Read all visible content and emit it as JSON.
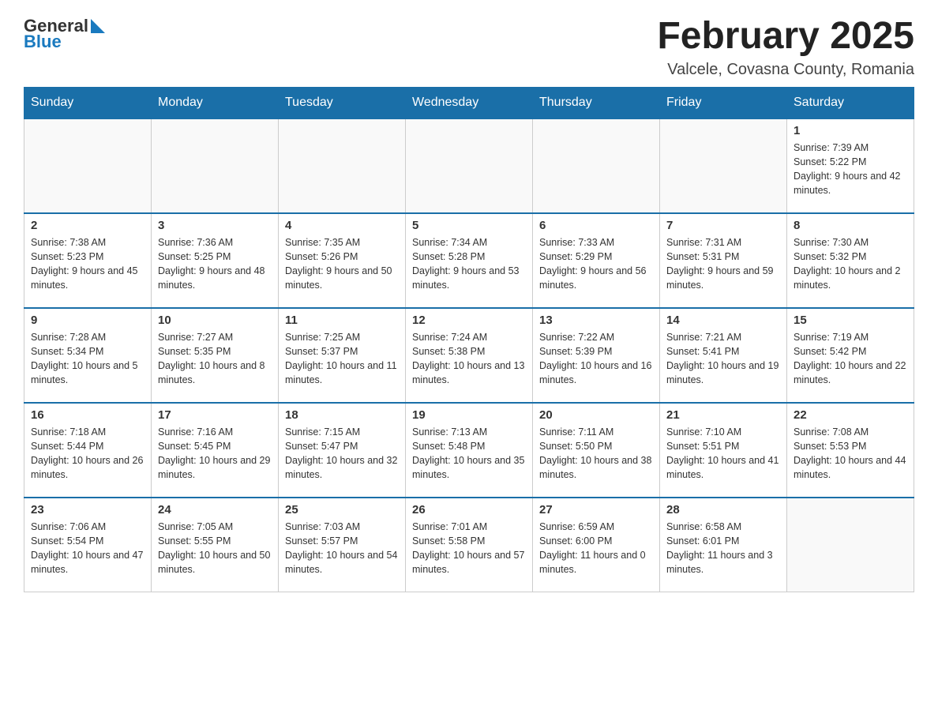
{
  "header": {
    "logo": {
      "text_general": "General",
      "text_blue": "Blue"
    },
    "title": "February 2025",
    "subtitle": "Valcele, Covasna County, Romania"
  },
  "days_of_week": [
    "Sunday",
    "Monday",
    "Tuesday",
    "Wednesday",
    "Thursday",
    "Friday",
    "Saturday"
  ],
  "weeks": [
    [
      {
        "day": "",
        "info": ""
      },
      {
        "day": "",
        "info": ""
      },
      {
        "day": "",
        "info": ""
      },
      {
        "day": "",
        "info": ""
      },
      {
        "day": "",
        "info": ""
      },
      {
        "day": "",
        "info": ""
      },
      {
        "day": "1",
        "info": "Sunrise: 7:39 AM\nSunset: 5:22 PM\nDaylight: 9 hours and 42 minutes."
      }
    ],
    [
      {
        "day": "2",
        "info": "Sunrise: 7:38 AM\nSunset: 5:23 PM\nDaylight: 9 hours and 45 minutes."
      },
      {
        "day": "3",
        "info": "Sunrise: 7:36 AM\nSunset: 5:25 PM\nDaylight: 9 hours and 48 minutes."
      },
      {
        "day": "4",
        "info": "Sunrise: 7:35 AM\nSunset: 5:26 PM\nDaylight: 9 hours and 50 minutes."
      },
      {
        "day": "5",
        "info": "Sunrise: 7:34 AM\nSunset: 5:28 PM\nDaylight: 9 hours and 53 minutes."
      },
      {
        "day": "6",
        "info": "Sunrise: 7:33 AM\nSunset: 5:29 PM\nDaylight: 9 hours and 56 minutes."
      },
      {
        "day": "7",
        "info": "Sunrise: 7:31 AM\nSunset: 5:31 PM\nDaylight: 9 hours and 59 minutes."
      },
      {
        "day": "8",
        "info": "Sunrise: 7:30 AM\nSunset: 5:32 PM\nDaylight: 10 hours and 2 minutes."
      }
    ],
    [
      {
        "day": "9",
        "info": "Sunrise: 7:28 AM\nSunset: 5:34 PM\nDaylight: 10 hours and 5 minutes."
      },
      {
        "day": "10",
        "info": "Sunrise: 7:27 AM\nSunset: 5:35 PM\nDaylight: 10 hours and 8 minutes."
      },
      {
        "day": "11",
        "info": "Sunrise: 7:25 AM\nSunset: 5:37 PM\nDaylight: 10 hours and 11 minutes."
      },
      {
        "day": "12",
        "info": "Sunrise: 7:24 AM\nSunset: 5:38 PM\nDaylight: 10 hours and 13 minutes."
      },
      {
        "day": "13",
        "info": "Sunrise: 7:22 AM\nSunset: 5:39 PM\nDaylight: 10 hours and 16 minutes."
      },
      {
        "day": "14",
        "info": "Sunrise: 7:21 AM\nSunset: 5:41 PM\nDaylight: 10 hours and 19 minutes."
      },
      {
        "day": "15",
        "info": "Sunrise: 7:19 AM\nSunset: 5:42 PM\nDaylight: 10 hours and 22 minutes."
      }
    ],
    [
      {
        "day": "16",
        "info": "Sunrise: 7:18 AM\nSunset: 5:44 PM\nDaylight: 10 hours and 26 minutes."
      },
      {
        "day": "17",
        "info": "Sunrise: 7:16 AM\nSunset: 5:45 PM\nDaylight: 10 hours and 29 minutes."
      },
      {
        "day": "18",
        "info": "Sunrise: 7:15 AM\nSunset: 5:47 PM\nDaylight: 10 hours and 32 minutes."
      },
      {
        "day": "19",
        "info": "Sunrise: 7:13 AM\nSunset: 5:48 PM\nDaylight: 10 hours and 35 minutes."
      },
      {
        "day": "20",
        "info": "Sunrise: 7:11 AM\nSunset: 5:50 PM\nDaylight: 10 hours and 38 minutes."
      },
      {
        "day": "21",
        "info": "Sunrise: 7:10 AM\nSunset: 5:51 PM\nDaylight: 10 hours and 41 minutes."
      },
      {
        "day": "22",
        "info": "Sunrise: 7:08 AM\nSunset: 5:53 PM\nDaylight: 10 hours and 44 minutes."
      }
    ],
    [
      {
        "day": "23",
        "info": "Sunrise: 7:06 AM\nSunset: 5:54 PM\nDaylight: 10 hours and 47 minutes."
      },
      {
        "day": "24",
        "info": "Sunrise: 7:05 AM\nSunset: 5:55 PM\nDaylight: 10 hours and 50 minutes."
      },
      {
        "day": "25",
        "info": "Sunrise: 7:03 AM\nSunset: 5:57 PM\nDaylight: 10 hours and 54 minutes."
      },
      {
        "day": "26",
        "info": "Sunrise: 7:01 AM\nSunset: 5:58 PM\nDaylight: 10 hours and 57 minutes."
      },
      {
        "day": "27",
        "info": "Sunrise: 6:59 AM\nSunset: 6:00 PM\nDaylight: 11 hours and 0 minutes."
      },
      {
        "day": "28",
        "info": "Sunrise: 6:58 AM\nSunset: 6:01 PM\nDaylight: 11 hours and 3 minutes."
      },
      {
        "day": "",
        "info": ""
      }
    ]
  ]
}
